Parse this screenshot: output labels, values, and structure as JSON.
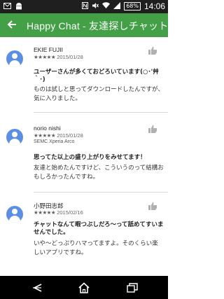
{
  "status_bar": {
    "time": "14:06",
    "battery": "68%",
    "icons": [
      "mail-icon",
      "android-icon",
      "nfc-icon",
      "mute-icon",
      "wifi-icon",
      "signal-icon",
      "battery-icon"
    ]
  },
  "app_bar": {
    "title": "Happy Chat - 友達探しチャット",
    "back_icon": "arrow-left-icon"
  },
  "reviews": [
    {
      "name": "EKIE FUJII",
      "stars": "★★★★★",
      "rating": 5,
      "date": "2015/01/28",
      "device": "",
      "title": "ユーザーさんが多くておどろいています(○･'艸｀･)",
      "body": "ものは試しと思ってダウンロードしたんですが、気に入りました。"
    },
    {
      "name": "norio nishi",
      "stars": "★★★★★",
      "rating": 5,
      "date": "2015/01/28",
      "device": "SEMC Xperia Arco",
      "title": "思ってた以上の盛り上がりをみせてます！",
      "body": "友達と始めたんですけど、こういうのって結構おもしろかったんですね。"
    },
    {
      "name": "小野田志郎",
      "stars": "★★★★★",
      "rating": 5,
      "date": "2015/02/16",
      "device": "",
      "title": "チャットなんて暇つぶしだろ〜って舐めてすいませんでした。",
      "body": "いや〜どっぷりハマってますよ。そのくらい楽しいアプリですね。"
    }
  ],
  "colors": {
    "app_bar": "#43a047",
    "avatar": "#5b8fe6",
    "status_bar": "#1f1f1f"
  }
}
